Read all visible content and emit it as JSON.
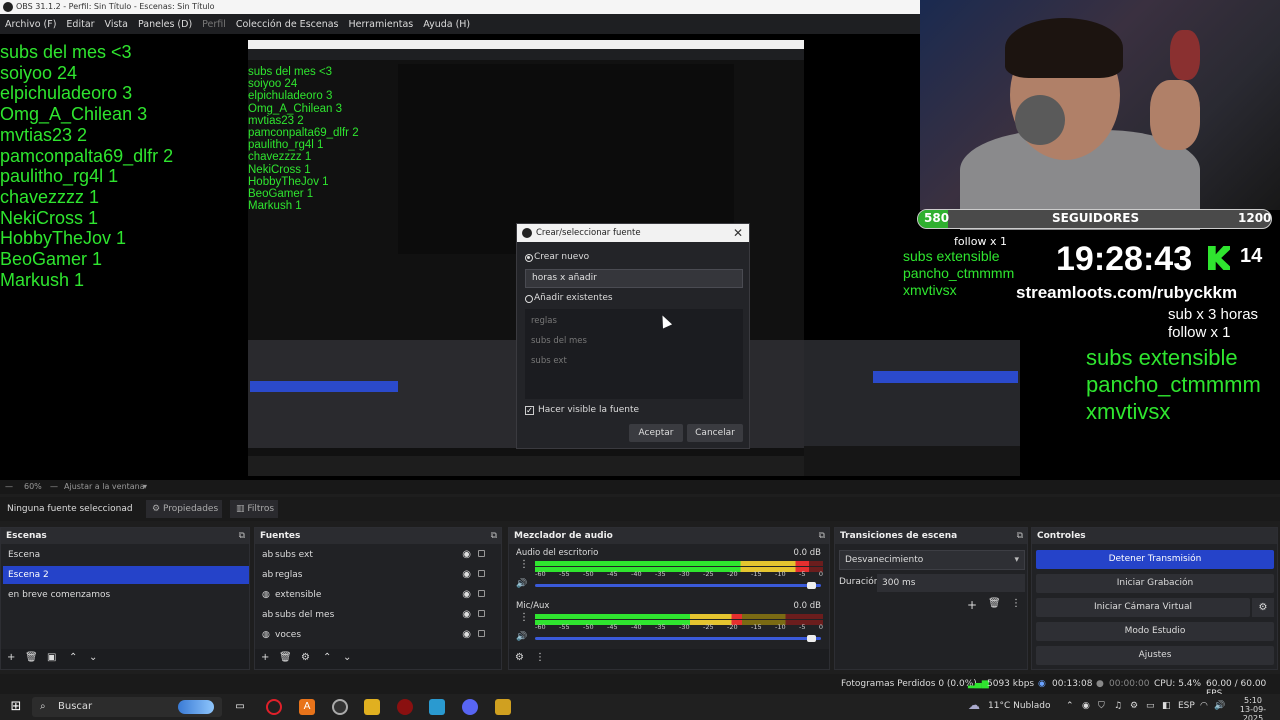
{
  "app": {
    "title": "OBS 31.1.2 - Perfil: Sin Título - Escenas: Sin Título",
    "menu": [
      "Archivo (F)",
      "Editar",
      "Vista",
      "Paneles (D)",
      "Perfil",
      "Colección de Escenas",
      "Herramientas",
      "Ayuda (H)"
    ]
  },
  "overlay": {
    "subs_list": [
      "subs del mes <3",
      "soiyoo 24",
      "elpichuladeoro 3",
      "Omg_A_Chilean 3",
      "mvtias23 2",
      "pamconpalta69_dlfr 2",
      "paulitho_rg4l 1",
      "chavezzzz 1",
      "NekiCross 1",
      "HobbyTheJov 1",
      "BeoGamer 1",
      "Markush 1"
    ],
    "followers_current": "580",
    "followers_label": "SEGUIDORES",
    "followers_goal": "1200",
    "followers_fraction": 0.48,
    "clock": "19:28:43",
    "kick_count": "14",
    "streamloots": "streamloots.com/rubyckkm",
    "promo_line1": "sub x 3 horas",
    "promo_line2": "follow x 1",
    "extensible_list": [
      "subs extensible",
      "pancho_ctmmmm",
      "xmvtivsx"
    ],
    "mid_follow": "follow x 1"
  },
  "dialog": {
    "title": "Crear/seleccionar fuente",
    "create_new_label": "Crear nuevo",
    "name_value": "horas x añadir",
    "add_existing_label": "Añadir existentes",
    "existing_items": [
      "reglas",
      "subs del mes",
      "subs ext"
    ],
    "visible_label": "Hacer visible la fuente",
    "ok_label": "Aceptar",
    "cancel_label": "Cancelar"
  },
  "zoombar": {
    "zoom": "60%",
    "fit_label": "Ajustar a la ventana"
  },
  "props_bar": {
    "no_source": "Ninguna fuente seleccionad",
    "properties": "Propiedades",
    "filters": "Filtros"
  },
  "scenes": {
    "title": "Escenas",
    "items": [
      "Escena",
      "Escena 2",
      "en breve comenzamos"
    ],
    "selected_index": 1
  },
  "sources": {
    "title": "Fuentes",
    "items": [
      {
        "name": "subs ext",
        "icon": "text-icon"
      },
      {
        "name": "reglas",
        "icon": "text-icon"
      },
      {
        "name": "extensible",
        "icon": "browser-icon"
      },
      {
        "name": "subs del mes",
        "icon": "text-icon"
      },
      {
        "name": "voces",
        "icon": "browser-icon"
      }
    ]
  },
  "mixer": {
    "title": "Mezclador de audio",
    "channels": [
      {
        "name": "Audio del escritorio",
        "db": "0.0 dB",
        "level": 0.95
      },
      {
        "name": "Mic/Aux",
        "db": "0.0 dB",
        "level": 0.72
      }
    ],
    "ticks": [
      "-60",
      "-55",
      "-50",
      "-45",
      "-40",
      "-35",
      "-30",
      "-25",
      "-20",
      "-15",
      "-10",
      "-5",
      "0"
    ]
  },
  "transitions": {
    "title": "Transiciones de escena",
    "selected": "Desvanecimiento",
    "duration_label": "Duración",
    "duration_value": "300 ms"
  },
  "controls": {
    "title": "Controles",
    "buttons": [
      "Detener Transmisión",
      "Iniciar Grabación",
      "Iniciar Cámara Virtual",
      "Modo Estudio",
      "Ajustes"
    ]
  },
  "status": {
    "dropped": "Fotogramas Perdidos 0 (0.0%)",
    "bitrate": "5093 kbps",
    "stream_time": "00:13:08",
    "rec_time": "00:00:00",
    "cpu": "CPU: 5.4%",
    "fps": "60.00 / 60.00 FPS"
  },
  "taskbar": {
    "search": "Buscar",
    "weather": "11°C  Nublado",
    "lang": "ESP",
    "time": "5:10",
    "date": "13-09-2025"
  },
  "colors": {
    "accent": "#2543c9",
    "overlay_green": "#2fe52f"
  }
}
